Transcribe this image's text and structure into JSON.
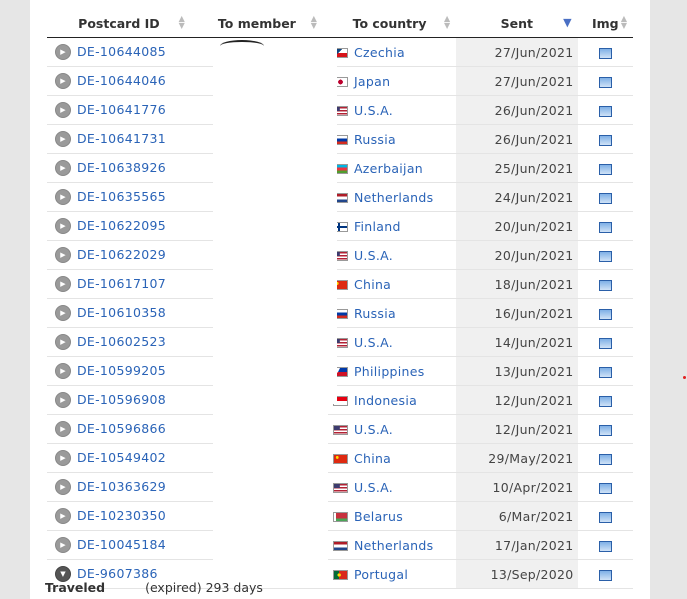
{
  "headers": {
    "id": "Postcard ID",
    "member": "To member",
    "country": "To country",
    "sent": "Sent",
    "img": "Img"
  },
  "rows": [
    {
      "id": "DE-10644085",
      "country": "Czechia",
      "sent": "27/Jun/2021",
      "flag": "czechia-flag"
    },
    {
      "id": "DE-10644046",
      "country": "Japan",
      "sent": "27/Jun/2021",
      "flag": "japan-flag"
    },
    {
      "id": "DE-10641776",
      "country": "U.S.A.",
      "sent": "26/Jun/2021",
      "flag": "usa-flag"
    },
    {
      "id": "DE-10641731",
      "country": "Russia",
      "sent": "26/Jun/2021",
      "flag": "russia-flag"
    },
    {
      "id": "DE-10638926",
      "country": "Azerbaijan",
      "sent": "25/Jun/2021",
      "flag": "azerbaijan-flag"
    },
    {
      "id": "DE-10635565",
      "country": "Netherlands",
      "sent": "24/Jun/2021",
      "flag": "netherlands-flag"
    },
    {
      "id": "DE-10622095",
      "country": "Finland",
      "sent": "20/Jun/2021",
      "flag": "finland-flag"
    },
    {
      "id": "DE-10622029",
      "country": "U.S.A.",
      "sent": "20/Jun/2021",
      "flag": "usa-flag"
    },
    {
      "id": "DE-10617107",
      "country": "China",
      "sent": "18/Jun/2021",
      "flag": "china-flag"
    },
    {
      "id": "DE-10610358",
      "country": "Russia",
      "sent": "16/Jun/2021",
      "flag": "russia-flag"
    },
    {
      "id": "DE-10602523",
      "country": "U.S.A.",
      "sent": "14/Jun/2021",
      "flag": "usa-flag"
    },
    {
      "id": "DE-10599205",
      "country": "Philippines",
      "sent": "13/Jun/2021",
      "flag": "philippines-flag"
    },
    {
      "id": "DE-10596908",
      "country": "Indonesia",
      "sent": "12/Jun/2021",
      "flag": "indonesia-flag"
    },
    {
      "id": "DE-10596866",
      "country": "U.S.A.",
      "sent": "12/Jun/2021",
      "flag": "usa-flag"
    },
    {
      "id": "DE-10549402",
      "country": "China",
      "sent": "29/May/2021",
      "flag": "china-flag"
    },
    {
      "id": "DE-10363629",
      "country": "U.S.A.",
      "sent": "10/Apr/2021",
      "flag": "usa-flag"
    },
    {
      "id": "DE-10230350",
      "country": "Belarus",
      "sent": "6/Mar/2021",
      "flag": "belarus-flag"
    },
    {
      "id": "DE-10045184",
      "country": "Netherlands",
      "sent": "17/Jan/2021",
      "flag": "netherlands-flag"
    },
    {
      "id": "DE-9607386",
      "country": "Portugal",
      "sent": "13/Sep/2020",
      "flag": "portugal-flag"
    }
  ],
  "footer": {
    "label": "Traveled",
    "value": "(expired) 293 days"
  },
  "colors": {
    "link": "#2a63b7",
    "sort_active": "#4a6fc4",
    "sent_bg": "#f0f0f0"
  }
}
